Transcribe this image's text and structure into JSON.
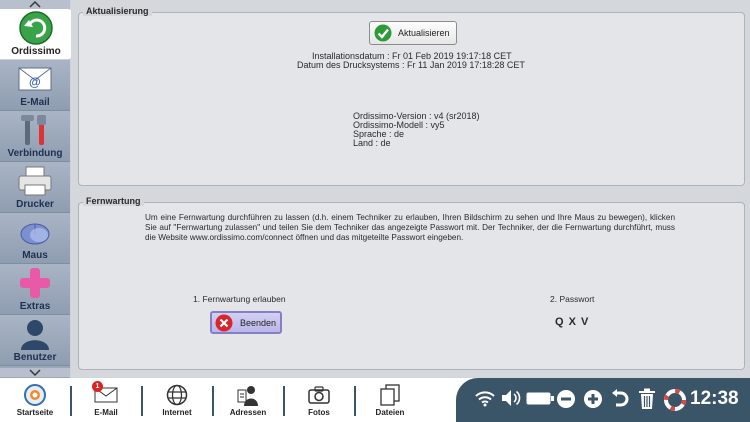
{
  "sidebar": {
    "items": [
      {
        "label": "Ordissimo",
        "icon": "back-arrow-icon",
        "active": true
      },
      {
        "label": "E-Mail",
        "icon": "email-icon"
      },
      {
        "label": "Verbindung",
        "icon": "tools-icon"
      },
      {
        "label": "Drucker",
        "icon": "printer-icon"
      },
      {
        "label": "Maus",
        "icon": "mouse-icon"
      },
      {
        "label": "Extras",
        "icon": "plus-icon"
      },
      {
        "label": "Benutzer",
        "icon": "user-icon"
      }
    ]
  },
  "update": {
    "title": "Aktualisierung",
    "button_label": "Aktualisieren",
    "install_date": "Installationsdatum : Fr 01 Feb 2019 19:17:18 CET",
    "print_date": "Datum des Drucksystems : Fr 11 Jan 2019 17:18:28 CET",
    "version": "Ordissimo-Version : v4 (sr2018)",
    "model": "Ordissimo-Modell : vy5",
    "language": "Sprache : de",
    "country": "Land : de"
  },
  "remote": {
    "title": "Fernwartung",
    "description": "Um eine Fernwartung durchführen zu lassen (d.h. einem Techniker zu erlauben, Ihren Bildschirm zu sehen und Ihre Maus zu bewegen), klicken Sie auf \"Fernwartung zulassen\" und teilen Sie dem Techniker das angezeigte Passwort mit. Der Techniker, der die Fernwartung durchführt, muss die Website www.ordissimo.com/connect öffnen und das mitgeteilte Passwort eingeben.",
    "step1": "1. Fernwartung erlauben",
    "end_button": "Beenden",
    "step2": "2. Passwort",
    "password": "Q X V"
  },
  "taskbar": {
    "items": [
      {
        "label": "Startseite",
        "icon": "home-logo-icon"
      },
      {
        "label": "E-Mail",
        "icon": "email-icon",
        "badge": "1"
      },
      {
        "label": "Internet",
        "icon": "globe-icon"
      },
      {
        "label": "Adressen",
        "icon": "contacts-icon"
      },
      {
        "label": "Fotos",
        "icon": "camera-icon"
      },
      {
        "label": "Dateien",
        "icon": "files-icon"
      }
    ],
    "tray": [
      "wifi-icon",
      "volume-icon",
      "battery-icon",
      "zoom-out-icon",
      "zoom-in-icon",
      "undo-icon",
      "trash-icon",
      "help-lifebuoy-icon"
    ],
    "clock": "12:38"
  },
  "colors": {
    "sidebar": "#9aa7b8",
    "taskbar_dark": "#3a5468",
    "end_button": "#bab6ea",
    "update_check": "#2e9b3a",
    "end_cross": "#d9262c"
  }
}
